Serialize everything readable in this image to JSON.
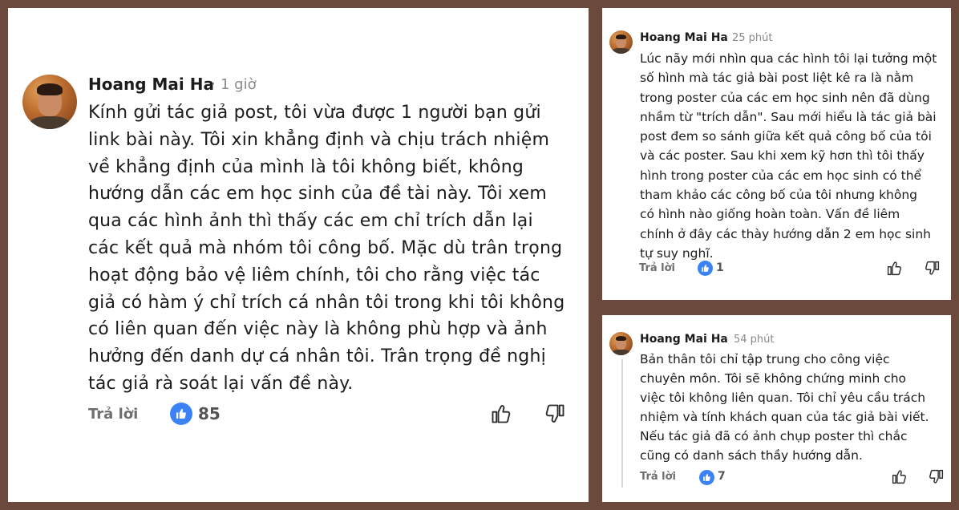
{
  "comments": [
    {
      "author": "Hoang Mai Ha",
      "separator": "·",
      "time": "1 giờ",
      "text": "Kính gửi tác giả post, tôi vừa được 1 người bạn gửi\nlink bài này. Tôi xin khẳng định và chịu trách nhiệm\nvề khẳng định của mình là tôi không biết, không\nhướng dẫn các em học sinh của đề tài này. Tôi xem\nqua các hình ảnh thì thấy các em chỉ trích dẫn lại\ncác kết quả mà nhóm tôi công bố. Mặc dù trân trọng\nhoạt động bảo vệ liêm chính, tôi cho rằng việc tác\ngiả có hàm ý chỉ trích cá nhân tôi trong khi tôi không\ncó liên quan đến việc này là không phù hợp và ảnh\nhưởng đến danh dự cá nhân tôi. Trân trọng đề nghị\ntác giả rà soát lại vấn đề này.",
      "reply_label": "Trả lời",
      "like_count": "85"
    },
    {
      "author": "Hoang Mai Ha",
      "separator": "·",
      "time": "25 phút",
      "text": "Lúc nãy mới nhìn qua các hình tôi lại tưởng một\nsố hình mà tác giả bài post liệt kê ra là nằm\ntrong poster của các em học sinh nên đã dùng\nnhầm từ \"trích dẫn\". Sau mới hiểu là tác giả bài\npost đem so sánh giữa kết quả công bố của tôi\nvà các poster. Sau khi xem kỹ hơn thì tôi thấy\nhình trong poster của các em học sinh có thể\ntham khảo các công bố của tôi nhưng không\ncó hình nào giống hoàn toàn. Vấn đề liêm\nchính ở đây các thày hướng dẫn 2 em học sinh\ntự suy nghĩ.",
      "reply_label": "Trả lời",
      "like_count": "1"
    },
    {
      "author": "Hoang Mai Ha",
      "separator": "·",
      "time": "54 phút",
      "text": "Bản thân tôi chỉ tập trung cho công việc\nchuyên môn. Tôi sẽ không chứng minh cho\nviệc tôi không liên quan. Tôi chỉ yêu cầu trách\nnhiệm và tính khách quan của tác giả bài viết.\nNếu tác giả đã có ảnh chụp poster thì chắc\ncũng có danh sách thầy hướng dẫn.",
      "reply_label": "Trả lời",
      "like_count": "7"
    }
  ],
  "icons": {
    "like_badge": "thumbs-up-icon",
    "like_button": "thumbs-up-outline-icon",
    "dislike_button": "thumbs-down-outline-icon"
  },
  "colors": {
    "background": "#6b4a3d",
    "like_blue": "#3b82f6",
    "text": "#1c1c1c",
    "muted": "#8a8a8a"
  }
}
